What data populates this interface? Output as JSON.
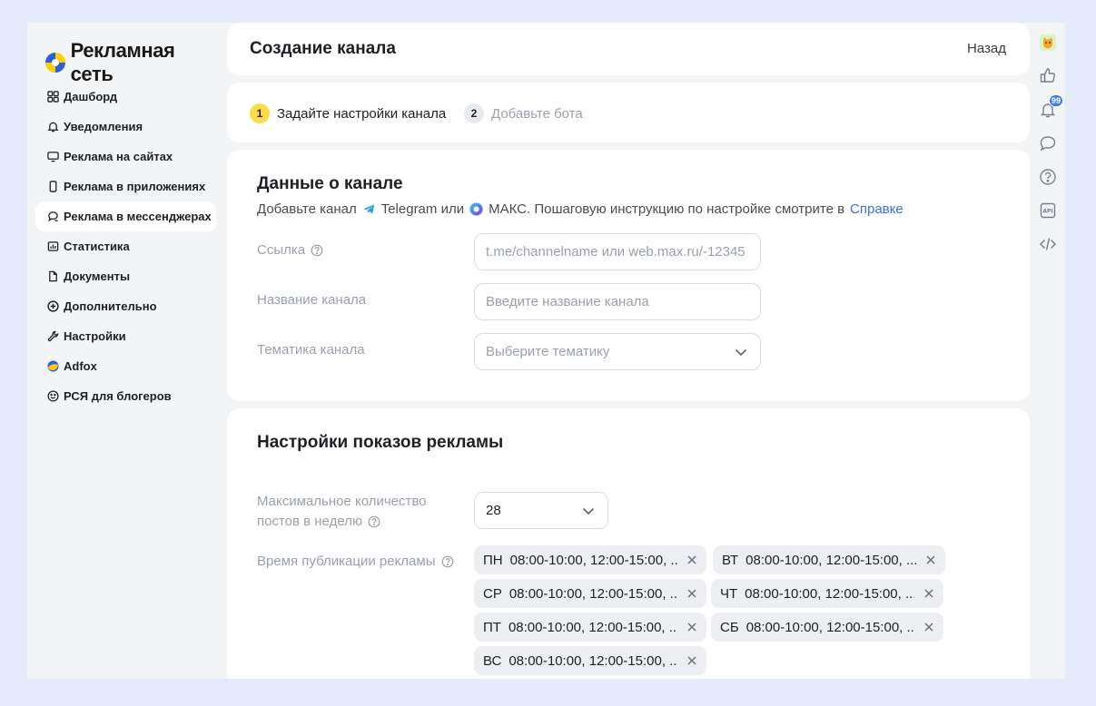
{
  "app": {
    "logo_text": "Рекламная сеть"
  },
  "sidebar": {
    "items": [
      {
        "label": "Дашборд",
        "icon": "grid-icon"
      },
      {
        "label": "Уведомления",
        "icon": "bell-icon"
      },
      {
        "label": "Реклама на сайтах",
        "icon": "monitor-icon"
      },
      {
        "label": "Реклама в приложениях",
        "icon": "phone-icon"
      },
      {
        "label": "Реклама в мессенджерах",
        "icon": "chat-icon",
        "active": true
      },
      {
        "label": "Статистика",
        "icon": "chart-icon"
      },
      {
        "label": "Документы",
        "icon": "document-icon"
      },
      {
        "label": "Дополнительно",
        "icon": "plus-circle-icon"
      },
      {
        "label": "Настройки",
        "icon": "wrench-icon"
      },
      {
        "label": "Adfox",
        "icon": "adfox-logo-icon"
      },
      {
        "label": "РСЯ для блогеров",
        "icon": "smile-icon"
      }
    ]
  },
  "header": {
    "title": "Создание канала",
    "back_label": "Назад"
  },
  "steps": [
    {
      "number": "1",
      "label": "Задайте настройки канала"
    },
    {
      "number": "2",
      "label": "Добавьте бота"
    }
  ],
  "channel": {
    "title": "Данные о канале",
    "subline_prefix": "Добавьте канал",
    "telegram": "Telegram или",
    "max_text": "МАКС. Пошаговую инструкцию по настройке смотрите в",
    "help_link": "Справке",
    "fields": {
      "link": {
        "label": "Ссылка",
        "placeholder": "t.me/channelname или web.max.ru/-12345"
      },
      "name": {
        "label": "Название канала",
        "placeholder": "Введите название канала"
      },
      "topic": {
        "label": "Тематика канала",
        "placeholder": "Выберите тематику"
      }
    }
  },
  "ad_settings": {
    "title": "Настройки показов рекламы",
    "max_posts_label_1": "Максимальное количество",
    "max_posts_label_2": "постов в неделю",
    "max_posts_value": "28",
    "publish_time_label": "Время публикации рекламы",
    "schedule": [
      {
        "day": "ПН",
        "times": "08:00-10:00, 12:00-15:00, ..."
      },
      {
        "day": "ВТ",
        "times": "08:00-10:00, 12:00-15:00, ..."
      },
      {
        "day": "СР",
        "times": "08:00-10:00, 12:00-15:00, ..."
      },
      {
        "day": "ЧТ",
        "times": "08:00-10:00, 12:00-15:00, ..."
      },
      {
        "day": "ПТ",
        "times": "08:00-10:00, 12:00-15:00, ..."
      },
      {
        "day": "СБ",
        "times": "08:00-10:00, 12:00-15:00, ..."
      },
      {
        "day": "ВС",
        "times": "08:00-10:00, 12:00-15:00, ..."
      }
    ]
  },
  "rail": {
    "notification_count": "99",
    "items": [
      "avatar",
      "like-icon",
      "bell-icon",
      "chat-bubble-icon",
      "help-icon",
      "api-icon",
      "code-icon"
    ],
    "api_text": "API"
  },
  "colors": {
    "accent_link": "#3a6fe0",
    "step_active": "#fddc4a",
    "badge": "#3f7df0"
  }
}
